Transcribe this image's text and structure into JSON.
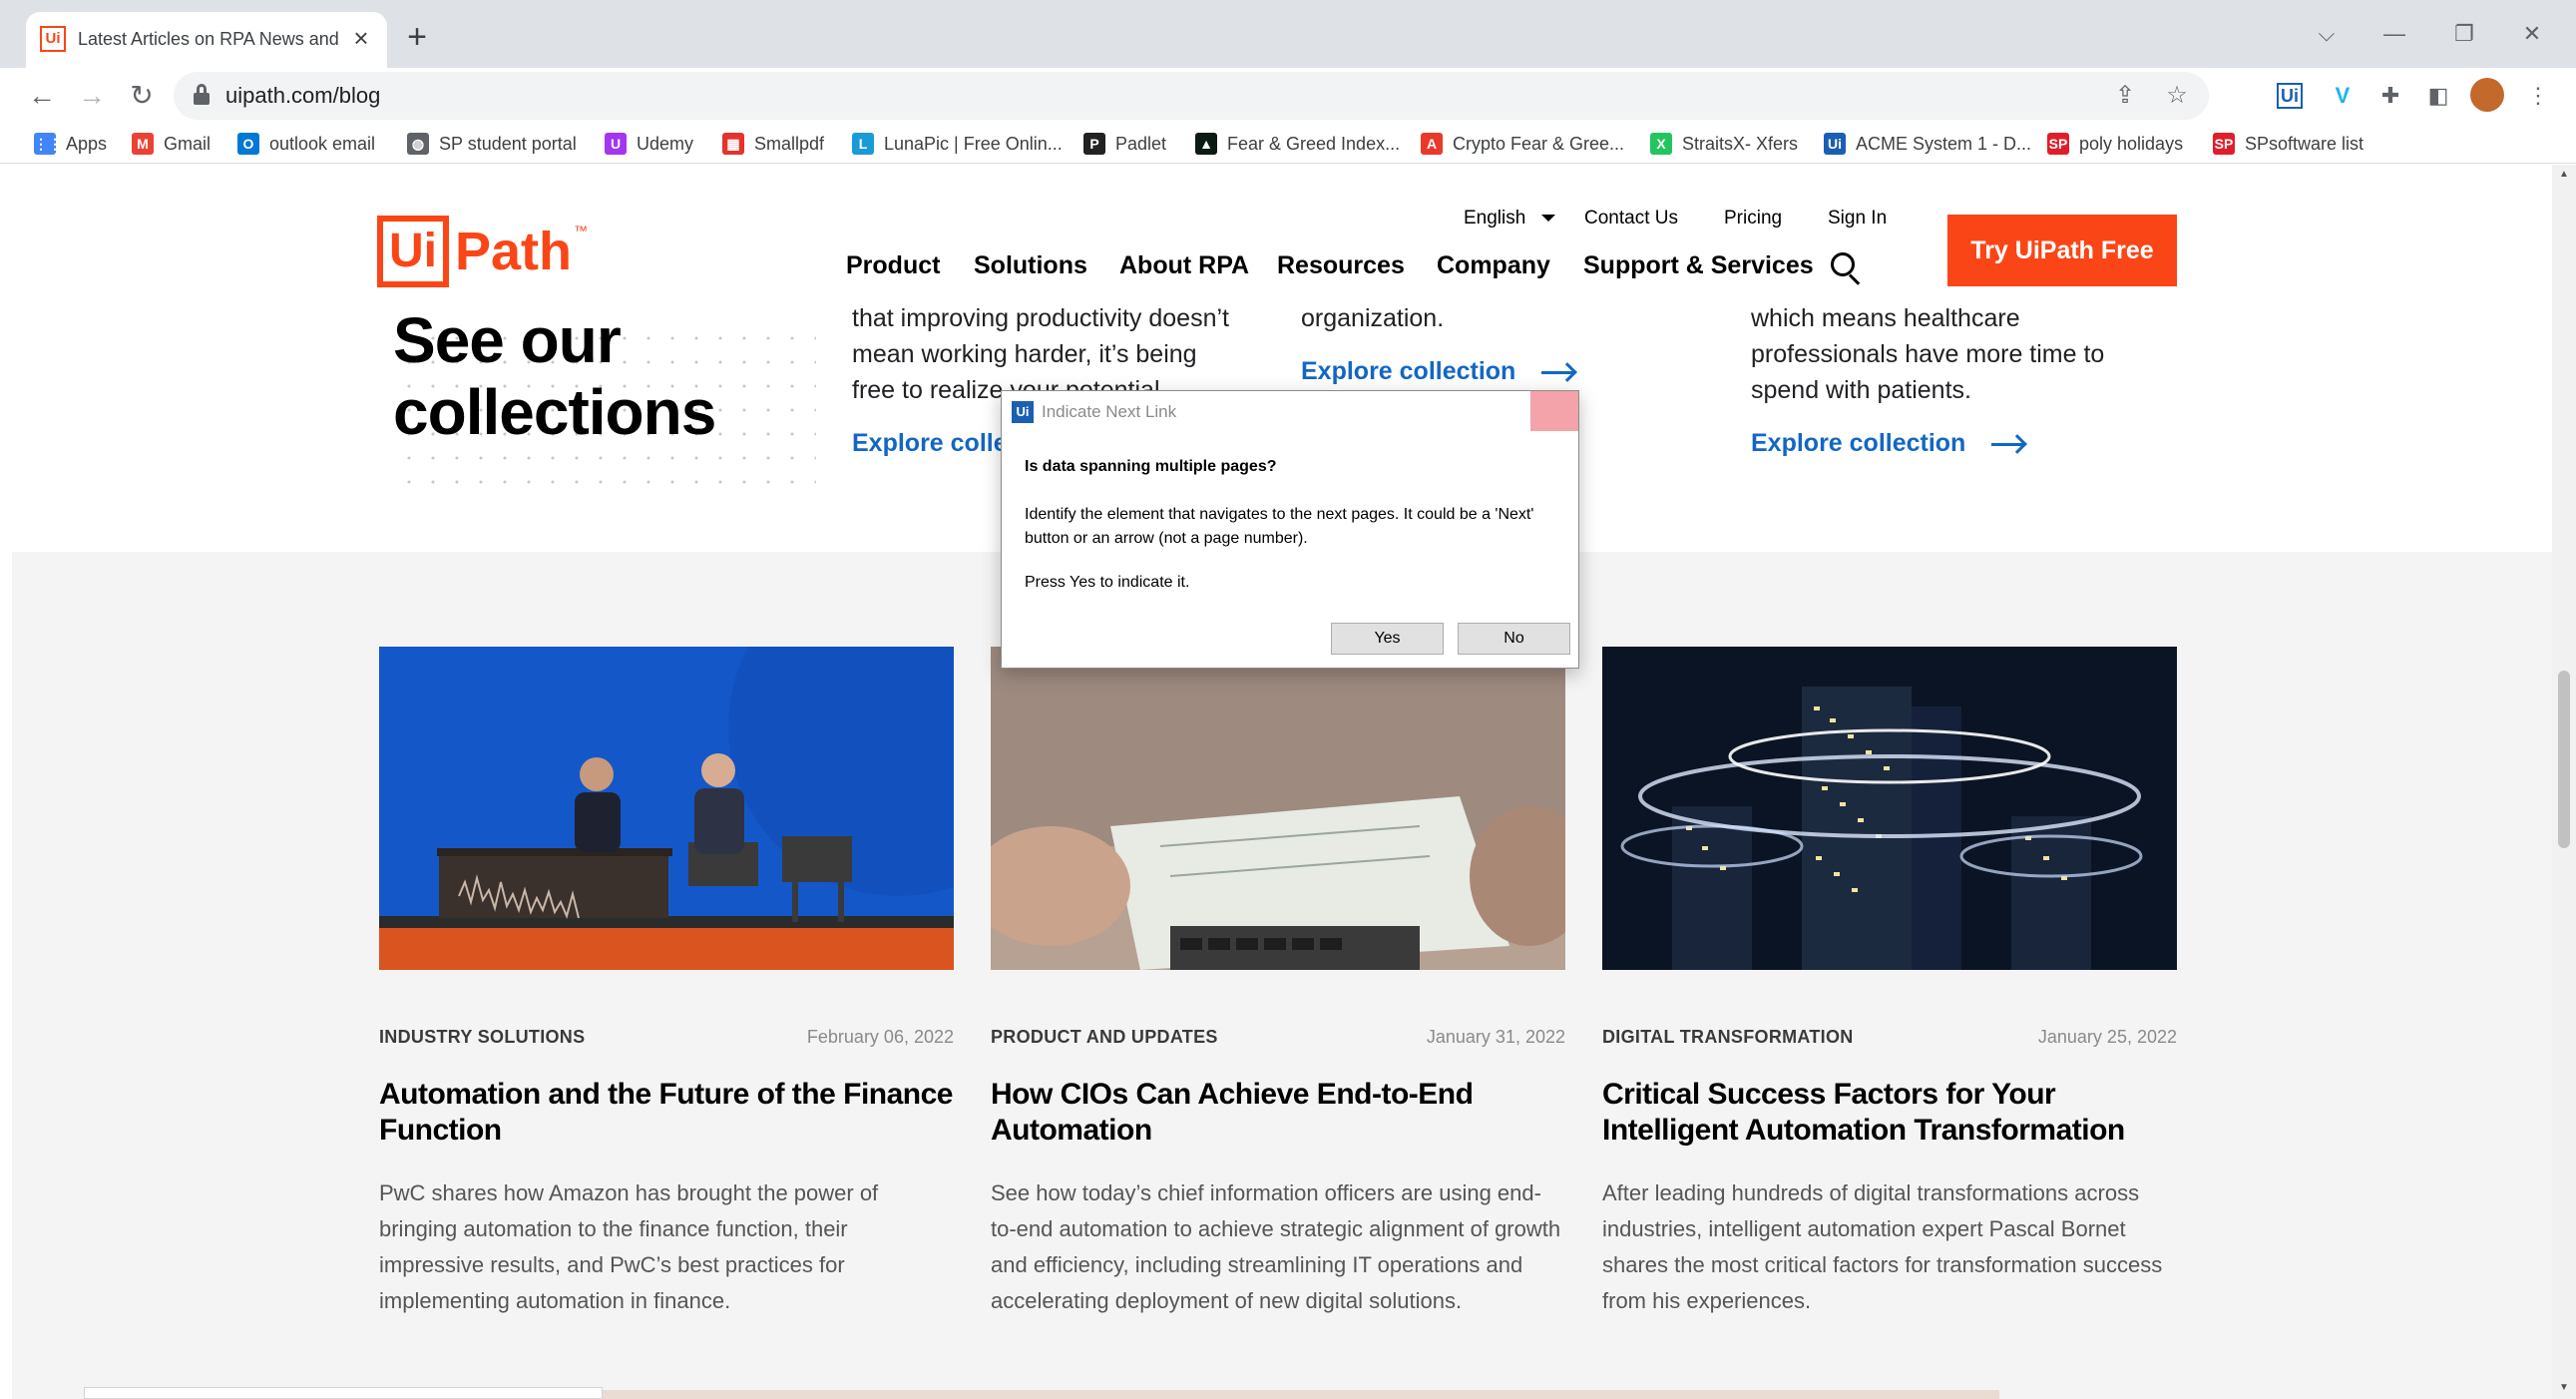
{
  "browser": {
    "tab_title": "Latest Articles on RPA News and",
    "tab_favicon": "Ui",
    "url": "uipath.com/blog",
    "window_controls": [
      "⌵",
      "—",
      "❐",
      "✕"
    ],
    "bookmarks": [
      {
        "label": "Apps",
        "icon": "apps-grid-icon",
        "color": "#4285f4",
        "glyph": "⋮⋮"
      },
      {
        "label": "Gmail",
        "icon": "gmail-icon",
        "color": "#ea4335",
        "glyph": "M"
      },
      {
        "label": "outlook email",
        "icon": "outlook-icon",
        "color": "#0078d4",
        "glyph": "O"
      },
      {
        "label": "SP student portal",
        "icon": "globe-icon",
        "color": "#5f6368",
        "glyph": "◍"
      },
      {
        "label": "Udemy",
        "icon": "udemy-icon",
        "color": "#a435f0",
        "glyph": "U"
      },
      {
        "label": "Smallpdf",
        "icon": "smallpdf-icon",
        "color": "#e5322d",
        "glyph": "▦"
      },
      {
        "label": "LunaPic | Free Onlin...",
        "icon": "lunapic-icon",
        "color": "#1a9bd7",
        "glyph": "L"
      },
      {
        "label": "Padlet",
        "icon": "padlet-icon",
        "color": "#222222",
        "glyph": "P"
      },
      {
        "label": "Fear & Greed Index...",
        "icon": "fear-greed-icon",
        "color": "#0b1b14",
        "glyph": "▲"
      },
      {
        "label": "Crypto Fear & Gree...",
        "icon": "crypto-icon",
        "color": "#e8392b",
        "glyph": "A"
      },
      {
        "label": "StraitsX- Xfers",
        "icon": "straitsx-icon",
        "color": "#22c55e",
        "glyph": "X"
      },
      {
        "label": "ACME System 1 - D...",
        "icon": "uipath-icon",
        "color": "#1a5fb4",
        "glyph": "Ui"
      },
      {
        "label": "poly holidays",
        "icon": "sp-icon",
        "color": "#e11d2a",
        "glyph": "SP"
      },
      {
        "label": "SPsoftware list",
        "icon": "sp-icon",
        "color": "#e11d2a",
        "glyph": "SP"
      }
    ]
  },
  "header": {
    "logo_box": "Ui",
    "logo_text": "Path",
    "logo_tm": "™",
    "language": "English",
    "contact": "Contact Us",
    "pricing": "Pricing",
    "signin": "Sign In",
    "nav": [
      "Product",
      "Solutions",
      "About RPA",
      "Resources",
      "Company",
      "Support & Services"
    ],
    "cta": "Try UiPath Free"
  },
  "collections": {
    "title_line1": "See our",
    "title_line2": "collections",
    "col1_lines": [
      "that improving productivity doesn’t",
      "mean working harder, it’s being",
      "free to realize your potential."
    ],
    "col2_lines": [
      "organization."
    ],
    "col3_lines": [
      "which means healthcare",
      "professionals have more time to",
      "spend with patients."
    ],
    "link": "Explore collection"
  },
  "articles": [
    {
      "category": "INDUSTRY SOLUTIONS",
      "date": "February 06, 2022",
      "title": "Automation and the Future of the Finance Function",
      "desc": "PwC shares how Amazon has brought the power of bringing automation to the finance function, their impressive results, and PwC’s best practices for implementing automation in finance."
    },
    {
      "category": "PRODUCT AND UPDATES",
      "date": "January 31, 2022",
      "title": "How CIOs Can Achieve End-to-End Automation",
      "desc": "See how today’s chief information officers are using end-to-end automation to achieve strategic alignment of growth and efficiency, including streamlining IT operations and accelerating deployment of new digital solutions."
    },
    {
      "category": "DIGITAL TRANSFORMATION",
      "date": "January 25, 2022",
      "title": "Critical Success Factors for Your Intelligent Automation Transformation",
      "desc": "After leading hundreds of digital transformations across industries, intelligent automation expert Pascal Bornet shares the most critical factors for transformation success from his experiences."
    }
  ],
  "dialog": {
    "icon": "Ui",
    "title": "Indicate Next Link",
    "question": "Is data spanning multiple pages?",
    "body": "Identify the element that navigates to the next pages. It could be a 'Next' button or an arrow (not a page number).",
    "body2": "Press Yes to indicate it.",
    "yes": "Yes",
    "no": "No"
  },
  "colors": {
    "brand_orange": "#fa4616",
    "link_blue": "#1267c4",
    "dialog_close": "#f3a3a9"
  }
}
